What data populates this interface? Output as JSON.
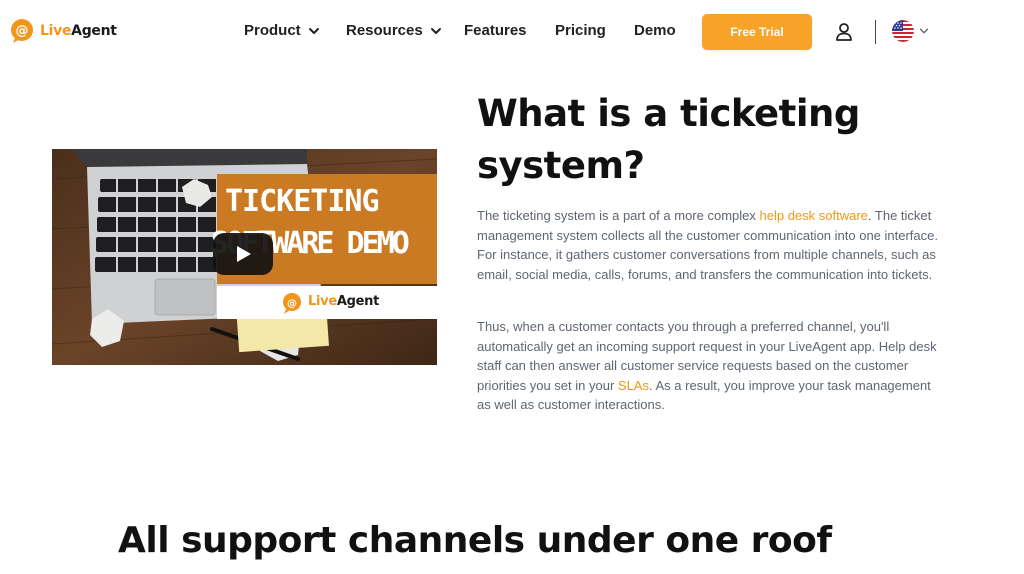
{
  "header": {
    "logo": {
      "part1": "Live",
      "part2": "Agent"
    },
    "nav": {
      "product": "Product",
      "resources": "Resources",
      "features": "Features",
      "pricing": "Pricing",
      "demo": "Demo"
    },
    "cta_label": "Free Trial",
    "icons": {
      "account": "user-icon",
      "language": "us-flag-icon",
      "dropdown": "chevron-down-icon"
    }
  },
  "video": {
    "title_line1": "TICKETING",
    "title_line2": "SOFTWARE DEMO",
    "brand_part1": "Live",
    "brand_part2": "Agent",
    "play_icon": "play-icon"
  },
  "main": {
    "title_line1": "What is a ticketing",
    "title_line2": "system?",
    "p1": {
      "before": "The ticketing system is a part of a more complex ",
      "link": "help desk software",
      "after": ". The ticket management system collects all the customer communication into one interface. For instance, it gathers customer conversations from multiple channels, such as email, social media, calls, forums, and transfers the communication into tickets."
    },
    "p2": {
      "before": "Thus, when a customer contacts you through a preferred channel, you'll automatically get an incoming support request in your LiveAgent app. Help desk staff can then answer all customer service requests based on the customer priorities you set in your ",
      "link": "SLAs",
      "after": ". As a result, you improve your task management as well as customer interactions."
    }
  },
  "section2": {
    "title": "All support channels under one roof"
  },
  "colors": {
    "accent": "#f7a327",
    "link": "#f2951b",
    "text": "#111111",
    "body_text": "#5e6670"
  }
}
